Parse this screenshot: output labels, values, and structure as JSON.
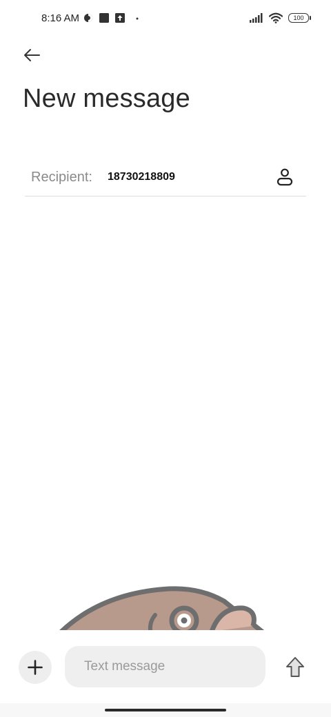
{
  "status_bar": {
    "time": "8:16 AM",
    "battery": "100",
    "icons": [
      "data-saver-icon",
      "square-notification-icon",
      "upload-notification-icon",
      "dot-icon",
      "signal-icon",
      "wifi-icon",
      "battery-icon"
    ]
  },
  "header": {
    "back_icon": "arrow-left-icon",
    "title": "New message"
  },
  "recipient": {
    "label": "Recipient:",
    "value": "18730218809",
    "contact_icon": "person-icon"
  },
  "compose": {
    "add_icon": "plus-icon",
    "placeholder": "Text message",
    "value": "",
    "send_icon": "send-arrow-icon"
  },
  "colors": {
    "background": "#ffffff",
    "input_background": "#efefef",
    "label_gray": "#8a8a8a",
    "divider": "#dcdcdc",
    "illustration_body": "#b89a8c",
    "illustration_outline": "#6e6e6e"
  }
}
